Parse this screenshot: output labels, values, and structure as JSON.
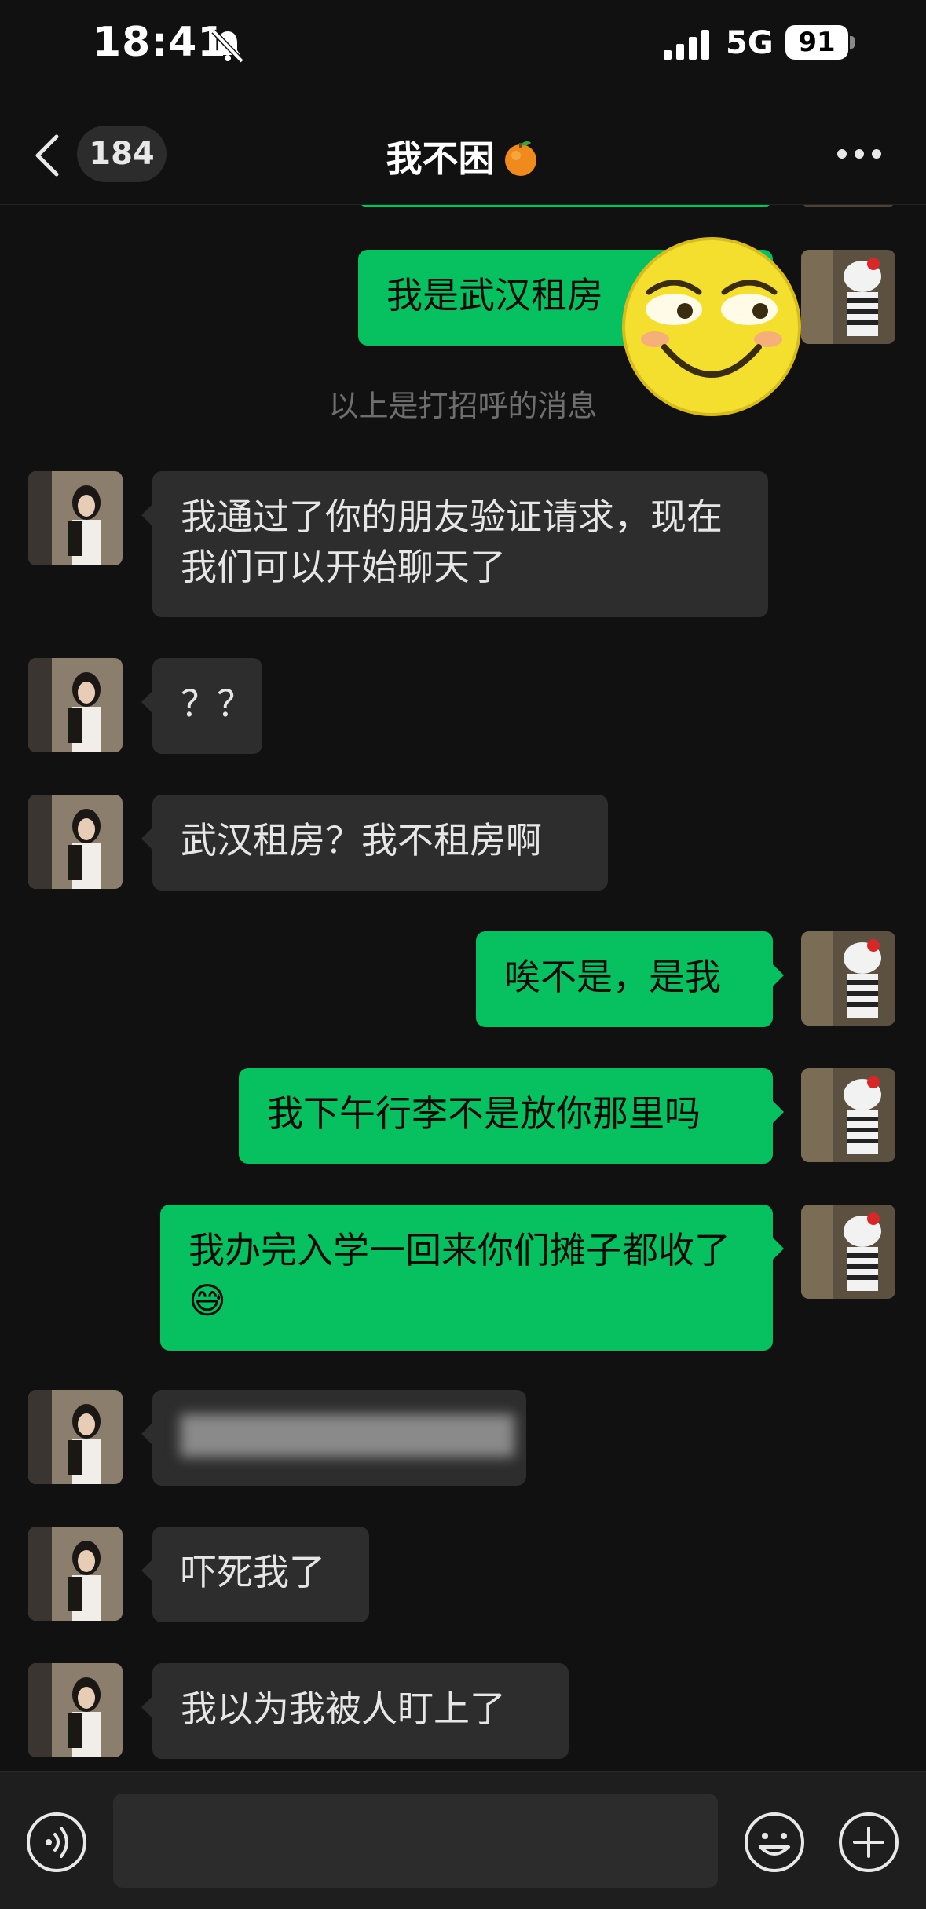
{
  "status_bar": {
    "time": "18:41",
    "network": "5G",
    "battery": "91"
  },
  "nav": {
    "back_count": "184",
    "title": "我不困"
  },
  "messages": [
    {
      "side": "out",
      "text": "我是武汉租房"
    },
    {
      "side": "system",
      "text": "以上是打招呼的消息"
    },
    {
      "side": "in",
      "text": "我通过了你的朋友验证请求，现在我们可以开始聊天了"
    },
    {
      "side": "in",
      "text": "？？"
    },
    {
      "side": "in",
      "text": "武汉租房？我不租房啊"
    },
    {
      "side": "out",
      "text": "唉不是，是我"
    },
    {
      "side": "out",
      "text": "我下午行李不是放你那里吗"
    },
    {
      "side": "out",
      "text": "我办完入学一回来你们摊子都收了😅"
    },
    {
      "side": "in",
      "text": "████████████",
      "blurred": true
    },
    {
      "side": "in",
      "text": "吓死我了"
    },
    {
      "side": "in",
      "text": "我以为我被人盯上了"
    }
  ],
  "colors": {
    "outgoing_bubble": "#07c160",
    "incoming_bubble": "#2d2d2d",
    "background": "#111111"
  },
  "icons": [
    "bell-off-icon",
    "signal-icon",
    "back-chevron-icon",
    "orange-emoji-icon",
    "more-dots-icon",
    "voice-icon",
    "emoji-icon",
    "plus-icon",
    "grin-sticker"
  ]
}
